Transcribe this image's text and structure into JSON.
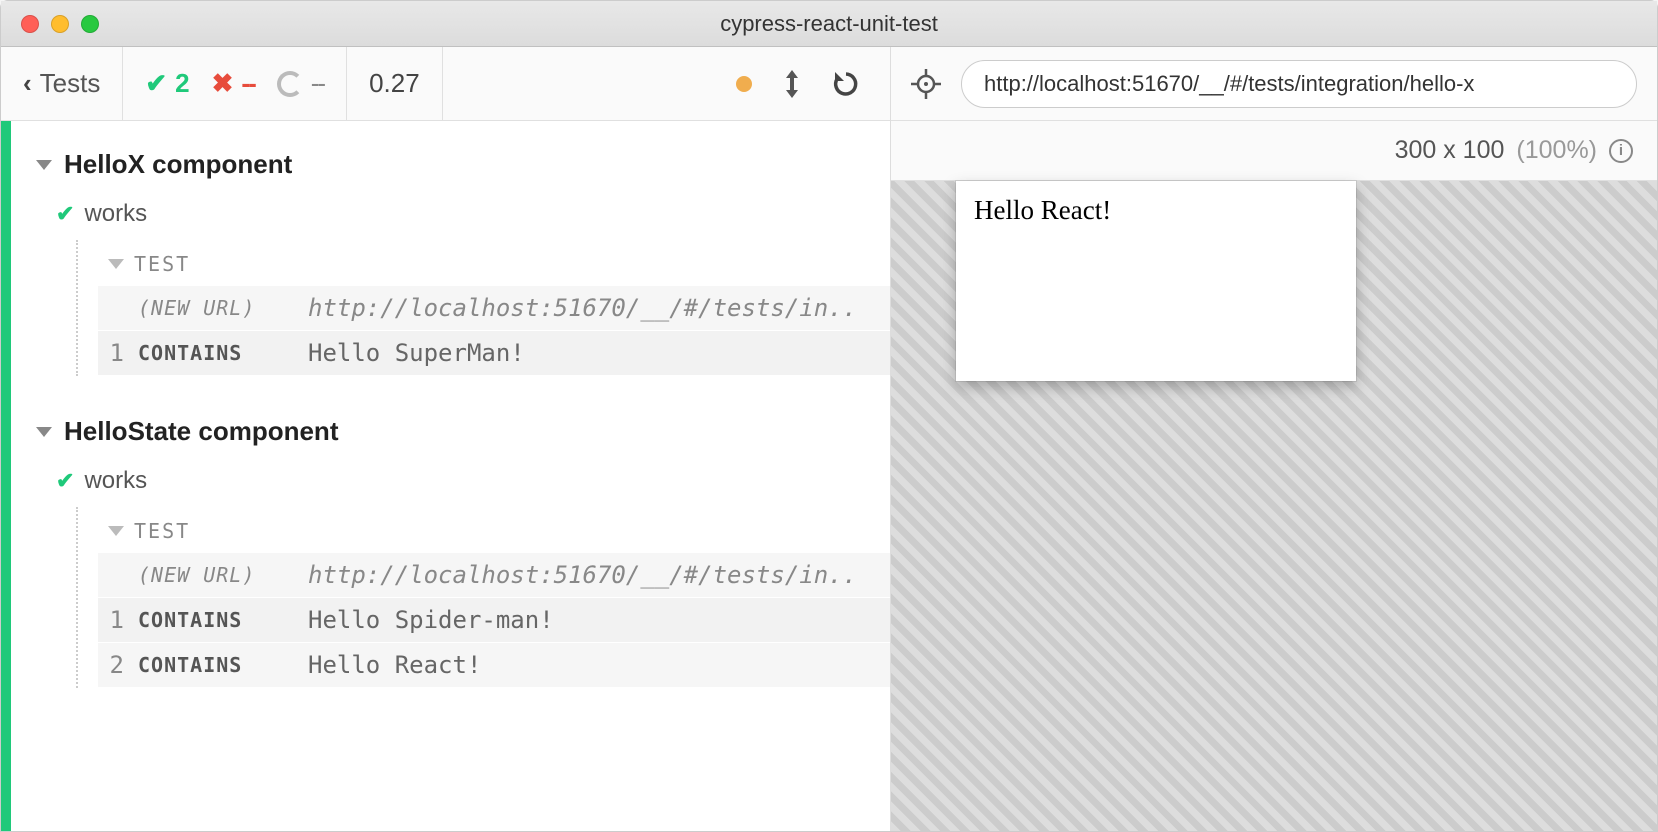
{
  "window": {
    "title": "cypress-react-unit-test"
  },
  "toolbar": {
    "back_label": "Tests",
    "pass_count": "2",
    "fail_count": "--",
    "pending_count": "--",
    "duration": "0.27"
  },
  "right": {
    "url": "http://localhost:51670/__/#/tests/integration/hello-x",
    "viewport_size": "300 x 100",
    "viewport_pct": "(100%)",
    "aut_text": "Hello React!"
  },
  "specs": [
    {
      "describe": "HelloX component",
      "its": [
        {
          "title": "works",
          "test_label": "TEST",
          "commands": [
            {
              "num": "",
              "name": "(NEW URL)",
              "msg": "http://localhost:51670/__/#/tests/in..",
              "url": true,
              "italic_name": true,
              "lighter": true
            },
            {
              "num": "1",
              "name": "CONTAINS",
              "msg": "Hello SuperMan!",
              "url": false,
              "italic_name": false,
              "lighter": false
            }
          ]
        }
      ]
    },
    {
      "describe": "HelloState component",
      "its": [
        {
          "title": "works",
          "test_label": "TEST",
          "commands": [
            {
              "num": "",
              "name": "(NEW URL)",
              "msg": "http://localhost:51670/__/#/tests/in..",
              "url": true,
              "italic_name": true,
              "lighter": true
            },
            {
              "num": "1",
              "name": "CONTAINS",
              "msg": "Hello Spider-man!",
              "url": false,
              "italic_name": false,
              "lighter": false
            },
            {
              "num": "2",
              "name": "CONTAINS",
              "msg": "Hello React!",
              "url": false,
              "italic_name": false,
              "lighter": true
            }
          ]
        }
      ]
    }
  ]
}
